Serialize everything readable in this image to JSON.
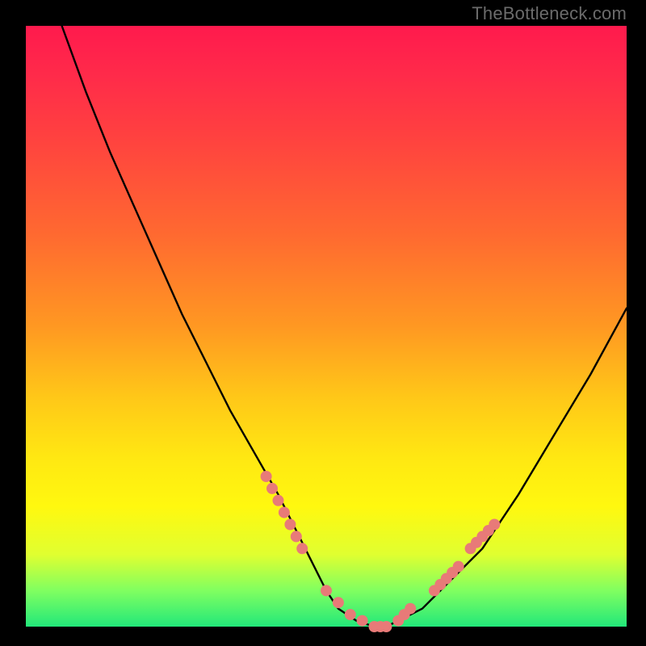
{
  "watermark": "TheBottleneck.com",
  "colors": {
    "frame": "#000000",
    "gradient_top": "#ff1a4d",
    "gradient_mid1": "#ff9822",
    "gradient_mid2": "#fff80f",
    "gradient_bottom": "#22e87a",
    "curve": "#000000",
    "dots": "#e87a78"
  },
  "chart_data": {
    "type": "line",
    "title": "",
    "xlabel": "",
    "ylabel": "",
    "xlim": [
      0,
      100
    ],
    "ylim": [
      0,
      100
    ],
    "grid": false,
    "legend": false,
    "note": "Bottleneck-style V-curve. x is normalized 0–100 across plot width, y is normalized 0–100 (0 = bottom/green, 100 = top/red). Values estimated from pixel positions.",
    "series": [
      {
        "name": "curve",
        "x": [
          6,
          10,
          14,
          18,
          22,
          26,
          30,
          34,
          38,
          42,
          45,
          48,
          50,
          52,
          55,
          58,
          60,
          62,
          66,
          70,
          76,
          82,
          88,
          94,
          100
        ],
        "y": [
          100,
          89,
          79,
          70,
          61,
          52,
          44,
          36,
          29,
          22,
          16,
          10,
          6,
          3,
          1,
          0,
          0,
          1,
          3,
          7,
          13,
          22,
          32,
          42,
          53
        ]
      }
    ],
    "highlight_points": {
      "name": "highlighted-dots",
      "note": "Pink marker clusters near the trough and partway up the right arm.",
      "x": [
        40,
        41,
        42,
        43,
        44,
        45,
        46,
        50,
        52,
        54,
        56,
        58,
        59,
        60,
        62,
        63,
        64,
        68,
        69,
        70,
        71,
        72,
        74,
        75,
        76,
        77,
        78
      ],
      "y": [
        25,
        23,
        21,
        19,
        17,
        15,
        13,
        6,
        4,
        2,
        1,
        0,
        0,
        0,
        1,
        2,
        3,
        6,
        7,
        8,
        9,
        10,
        13,
        14,
        15,
        16,
        17
      ]
    }
  }
}
